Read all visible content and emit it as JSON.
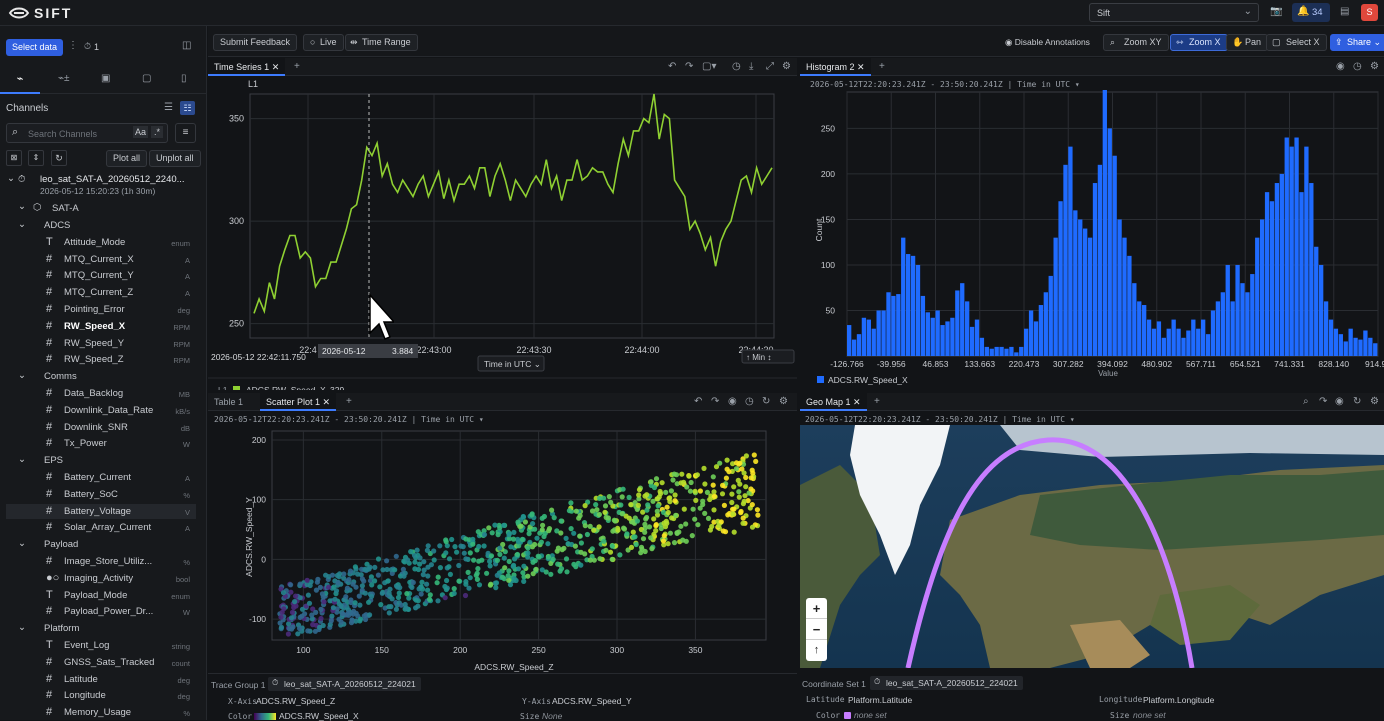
{
  "app": {
    "logo": "SIFT",
    "workspace": "Sift",
    "notif_count": "34",
    "avatar": "S"
  },
  "toolbar": {
    "select_data": "Select data",
    "pin_count": "1",
    "submit_feedback": "Submit Feedback",
    "live": "Live",
    "time_range": "Time Range",
    "disable_annotations": "Disable Annotations",
    "zoom_xy": "Zoom XY",
    "zoom_x": "Zoom X",
    "pan": "Pan",
    "select_x": "Select X",
    "share": "Share"
  },
  "sidebar": {
    "channels_title": "Channels",
    "search_placeholder": "Search Channels",
    "case_label": "Aa",
    "regex_label": ".*",
    "plot_all": "Plot all",
    "unplot_all": "Unplot all",
    "run_name": "leo_sat_SAT-A_20260512_2240...",
    "run_meta": "2026-05-12 15:20:23 (1h 30m)",
    "asset": "SAT-A",
    "groups": [
      {
        "name": "ADCS",
        "items": [
          {
            "label": "Attitude_Mode",
            "unit": "enum",
            "icon": "T"
          },
          {
            "label": "MTQ_Current_X",
            "unit": "A",
            "icon": "#"
          },
          {
            "label": "MTQ_Current_Y",
            "unit": "A",
            "icon": "#"
          },
          {
            "label": "MTQ_Current_Z",
            "unit": "A",
            "icon": "#"
          },
          {
            "label": "Pointing_Error",
            "unit": "deg",
            "icon": "#"
          },
          {
            "label": "RW_Speed_X",
            "unit": "RPM",
            "icon": "#",
            "bold": true
          },
          {
            "label": "RW_Speed_Y",
            "unit": "RPM",
            "icon": "#"
          },
          {
            "label": "RW_Speed_Z",
            "unit": "RPM",
            "icon": "#"
          }
        ]
      },
      {
        "name": "Comms",
        "items": [
          {
            "label": "Data_Backlog",
            "unit": "MB",
            "icon": "#"
          },
          {
            "label": "Downlink_Data_Rate",
            "unit": "kB/s",
            "icon": "#"
          },
          {
            "label": "Downlink_SNR",
            "unit": "dB",
            "icon": "#"
          },
          {
            "label": "Tx_Power",
            "unit": "W",
            "icon": "#"
          }
        ]
      },
      {
        "name": "EPS",
        "items": [
          {
            "label": "Battery_Current",
            "unit": "A",
            "icon": "#"
          },
          {
            "label": "Battery_SoC",
            "unit": "%",
            "icon": "#"
          },
          {
            "label": "Battery_Voltage",
            "unit": "V",
            "icon": "#",
            "hl": true
          },
          {
            "label": "Solar_Array_Current",
            "unit": "A",
            "icon": "#"
          }
        ]
      },
      {
        "name": "Payload",
        "items": [
          {
            "label": "Image_Store_Utiliz...",
            "unit": "%",
            "icon": "#"
          },
          {
            "label": "Imaging_Activity",
            "unit": "bool",
            "icon": "b"
          },
          {
            "label": "Payload_Mode",
            "unit": "enum",
            "icon": "T"
          },
          {
            "label": "Payload_Power_Dr...",
            "unit": "W",
            "icon": "#"
          }
        ]
      },
      {
        "name": "Platform",
        "items": [
          {
            "label": "Event_Log",
            "unit": "string",
            "icon": "T"
          },
          {
            "label": "GNSS_Sats_Tracked",
            "unit": "count",
            "icon": "#"
          },
          {
            "label": "Latitude",
            "unit": "deg",
            "icon": "#"
          },
          {
            "label": "Longitude",
            "unit": "deg",
            "icon": "#"
          },
          {
            "label": "Memory_Usage",
            "unit": "%",
            "icon": "#"
          }
        ]
      }
    ]
  },
  "ts": {
    "tab": "Time Series 1",
    "axis_label": "L1",
    "yticks": [
      "350",
      "300",
      "250"
    ],
    "xticks": [
      "22:4",
      "22:43:00",
      "22:43:30",
      "22:44:00",
      "22:44:30"
    ],
    "cursor_time": "2026-05-12 22:42:11.750",
    "tooltip_time": "2026-05-12",
    "tooltip_tail": "3.884",
    "time_in_utc": "Time in UTC",
    "min_label": "Min",
    "legend_axis": "L1",
    "legend_channel": "ADCS.RW_Speed_X",
    "legend_value": "329",
    "color": "#8fd032"
  },
  "hist": {
    "tab": "Histogram 2",
    "range": "2026-05-12T22:20:23.241Z - 23:50:20.241Z | Time in UTC ▾",
    "ylabel": "Count",
    "xlabel": "Value",
    "yticks": [
      "250",
      "200",
      "150",
      "100",
      "50"
    ],
    "xticks": [
      "-126.766",
      "-39.956",
      "46.853",
      "133.663",
      "220.473",
      "307.282",
      "394.092",
      "480.902",
      "567.711",
      "654.521",
      "741.331",
      "828.140",
      "914.95"
    ],
    "legend": "ADCS.RW_Speed_X",
    "color": "#1f6bff",
    "chart_data": {
      "type": "bar",
      "xlabel": "Value",
      "ylabel": "Count",
      "ylim": [
        0,
        290
      ],
      "xlim": [
        -126.766,
        914.95
      ],
      "values": [
        34,
        18,
        24,
        42,
        40,
        30,
        50,
        50,
        70,
        66,
        68,
        130,
        112,
        110,
        100,
        66,
        48,
        42,
        50,
        34,
        38,
        42,
        72,
        80,
        60,
        32,
        40,
        20,
        10,
        8,
        10,
        10,
        8,
        10,
        4,
        10,
        30,
        50,
        38,
        56,
        70,
        88,
        130,
        170,
        210,
        230,
        160,
        150,
        140,
        130,
        190,
        210,
        300,
        250,
        220,
        150,
        130,
        110,
        80,
        60,
        56,
        40,
        30,
        38,
        20,
        30,
        40,
        30,
        20,
        28,
        40,
        30,
        40,
        24,
        50,
        60,
        70,
        100,
        60,
        100,
        80,
        70,
        90,
        130,
        150,
        180,
        170,
        190,
        200,
        240,
        230,
        240,
        180,
        230,
        190,
        120,
        100,
        60,
        40,
        30,
        24,
        16,
        30,
        20,
        18,
        28,
        20,
        14
      ]
    }
  },
  "table": {
    "tab": "Table 1"
  },
  "scatter": {
    "tab": "Scatter Plot 1",
    "range": "2026-05-12T22:20:23.241Z - 23:50:20.241Z | Time in UTC ▾",
    "xlabel": "ADCS.RW_Speed_Z",
    "ylabel": "ADCS.RW_Speed_Y",
    "yticks": [
      "200",
      "100",
      "0",
      "-100"
    ],
    "xticks": [
      "100",
      "150",
      "200",
      "250",
      "300",
      "350"
    ],
    "trace_group": "Trace Group 1",
    "run": "leo_sat_SAT-A_20260512_224021",
    "x_axis_label": "X-Axis",
    "x_axis_value": "ADCS.RW_Speed_Z",
    "y_axis_label": "Y-Axis",
    "y_axis_value": "ADCS.RW_Speed_Y",
    "color_label": "Color",
    "color_value": "ADCS.RW_Speed_X",
    "size_label": "Size",
    "size_value": "None"
  },
  "geo": {
    "tab": "Geo Map 1",
    "range": "2026-05-12T22:20:23.241Z - 23:50:20.241Z | Time in UTC ▾",
    "coord_set": "Coordinate Set 1",
    "run": "leo_sat_SAT-A_20260512_224021",
    "lat_label": "Latitude",
    "lat_value": "Platform.Latitude",
    "lon_label": "Longitude",
    "lon_value": "Platform.Longitude",
    "color_label": "Color",
    "color_value": "none set",
    "size_label": "Size",
    "size_value": "none set",
    "zoom_in": "+",
    "zoom_out": "−",
    "north": "↑",
    "track_color": "#c77dff"
  }
}
